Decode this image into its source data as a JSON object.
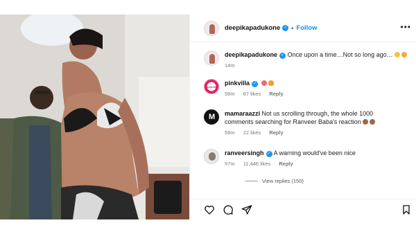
{
  "post": {
    "username": "deepikapadukone",
    "follow_label": "Follow",
    "separator": "•",
    "more_label": "•••",
    "caption": "Once upon a time…Not so long ago…",
    "caption_time": "14m",
    "image_alt": "Photo of a woman in a black and white bikini with a man standing in the background"
  },
  "comments": [
    {
      "username": "pinkvilla",
      "avatar_text": "pinkvilla",
      "text": "",
      "time": "59m",
      "likes": "67 likes",
      "reply_label": "Reply"
    },
    {
      "username": "mamaraazzi",
      "avatar_text": "M",
      "text": "Not us scrolling through, the whole 1000 comments searching for Ranveer Baba's reaction",
      "time": "59m",
      "likes": "22 likes",
      "reply_label": "Reply"
    },
    {
      "username": "ranveersingh",
      "text": "A warning would've been nice",
      "time": "57m",
      "likes": "11,446 likes",
      "reply_label": "Reply"
    }
  ],
  "view_replies": "View replies (150)",
  "actions": [
    "heart-icon",
    "comment-icon",
    "share-icon",
    "bookmark-icon"
  ],
  "colors": {
    "accent": "#0095f6",
    "verified": "#1b95f5",
    "border": "#efefef"
  }
}
